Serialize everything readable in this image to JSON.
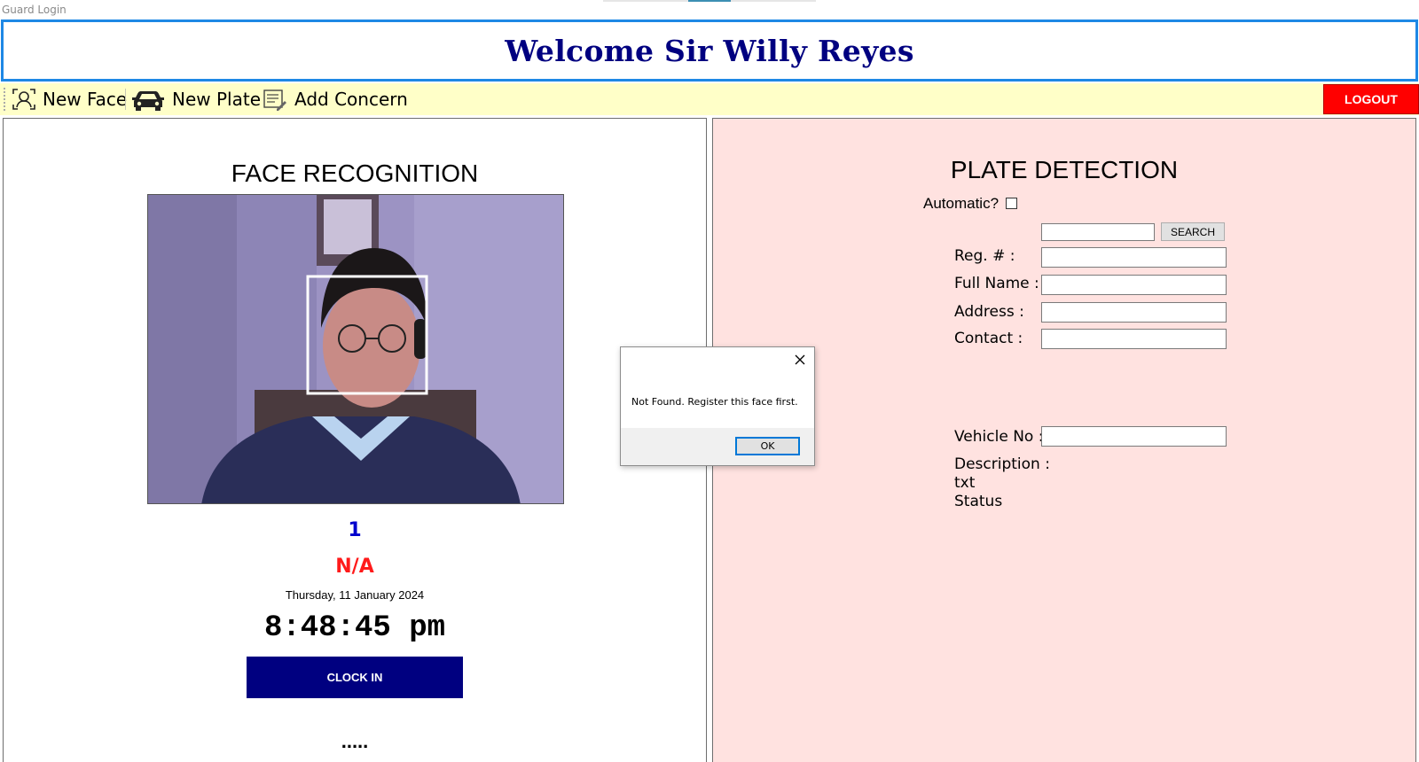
{
  "window": {
    "title": "Guard Login"
  },
  "banner": {
    "welcome_text": "Welcome Sir Willy Reyes"
  },
  "toolbar": {
    "new_face_label": "New Face",
    "new_plate_label": "New Plate",
    "add_concern_label": "Add Concern",
    "logout_label": "LOGOUT",
    "icons": [
      "face-scan-icon",
      "car-icon",
      "concern-form-icon"
    ]
  },
  "face": {
    "title": "FACE RECOGNITION",
    "count": "1",
    "name": "N/A",
    "date": "Thursday, 11 January 2024",
    "time": "8:48:45 pm",
    "clock_in_label": "CLOCK IN",
    "status_dots": "....."
  },
  "plate": {
    "title": "PLATE DETECTION",
    "automatic_label": "Automatic?",
    "automatic_checked": false,
    "search_label": "SEARCH",
    "search_value": "",
    "reg_label": "Reg. # :",
    "reg_value": "",
    "fullname_label": "Full Name :",
    "fullname_value": "",
    "address_label": "Address :",
    "address_value": "",
    "contact_label": "Contact :",
    "contact_value": "",
    "vehicle_label": "Vehicle No :",
    "vehicle_value": "",
    "description_label": "Description :",
    "description_value": "txt",
    "status_label": "Status"
  },
  "dialog": {
    "message": "Not Found. Register this face first.",
    "ok_label": "OK"
  },
  "colors": {
    "banner_text": "#000080",
    "banner_border": "#1e88e5",
    "toolbar_bg": "#ffffc8",
    "logout_bg": "#ff0000",
    "clock_in_bg": "#000080",
    "plate_panel_bg": "#ffe2e0",
    "count_color": "#0000cd",
    "name_color": "#ff1a1a"
  }
}
